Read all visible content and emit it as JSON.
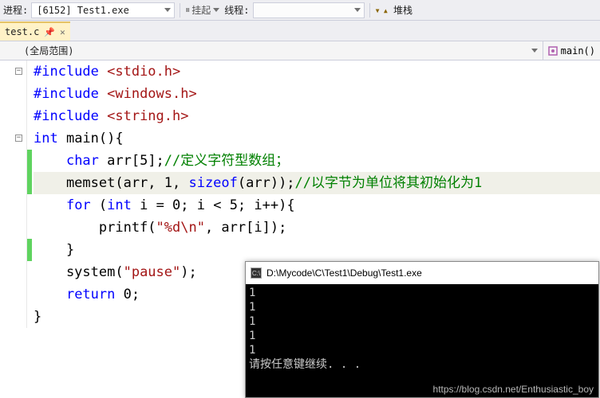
{
  "toolbar": {
    "process_label": "进程:",
    "process_value": "[6152] Test1.exe",
    "suspend_label": "挂起",
    "thread_label": "线程:",
    "thread_value": "",
    "stack_label": "堆栈"
  },
  "tab": {
    "filename": "test.c"
  },
  "scope": {
    "left": "(全局范围)",
    "right": "main()"
  },
  "code": {
    "l1_a": "#include ",
    "l1_b": "<stdio.h>",
    "l2_a": "#include ",
    "l2_b": "<windows.h>",
    "l3_a": "#include ",
    "l3_b": "<string.h>",
    "l4_a": "int",
    "l4_b": " main(){",
    "l5_a": "    ",
    "l5_b": "char",
    "l5_c": " arr[5];",
    "l5_d": "//定义字符型数组；",
    "l6_a": "    memset(arr, 1, ",
    "l6_b": "sizeof",
    "l6_c": "(arr));",
    "l6_d": "//以字节为单位将其初始化为1",
    "l7_a": "    ",
    "l7_b": "for",
    "l7_c": " (",
    "l7_d": "int",
    "l7_e": " i = 0; i < 5; i++){",
    "l8_a": "        printf(",
    "l8_b": "\"%d\\n\"",
    "l8_c": ", arr[i]);",
    "l9": "    }",
    "l10_a": "    system(",
    "l10_b": "\"pause\"",
    "l10_c": ");",
    "l11_a": "    ",
    "l11_b": "return",
    "l11_c": " 0;",
    "l12": "}"
  },
  "console": {
    "title": "D:\\Mycode\\C\\Test1\\Debug\\Test1.exe",
    "out1": "1",
    "out2": "1",
    "out3": "1",
    "out4": "1",
    "out5": "1",
    "prompt": "请按任意键继续. . ."
  },
  "watermark": "https://blog.csdn.net/Enthusiastic_boy"
}
